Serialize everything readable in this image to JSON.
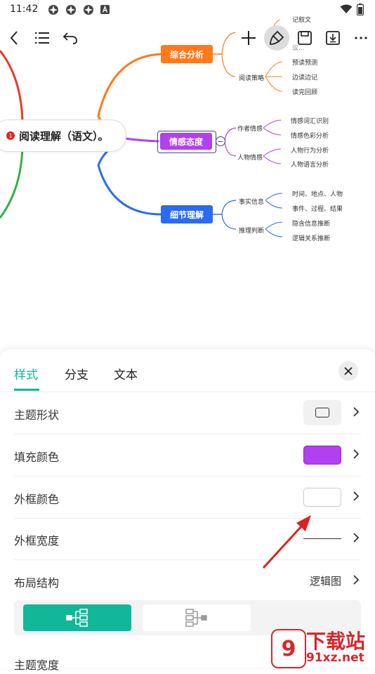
{
  "status_bar": {
    "time": "11:42"
  },
  "central_topic": {
    "label": "阅读理解（语文）。"
  },
  "branches": [
    {
      "label": "综合分析",
      "color": "#ff7a1a",
      "children": [
        {
          "label": "",
          "leaves": [
            "记叙文",
            "",
            "议..."
          ]
        },
        {
          "label": "阅读策略",
          "leaves": [
            "预读预测",
            "边读边记",
            "读完回顾"
          ]
        }
      ]
    },
    {
      "label": "情感态度",
      "color": "#b23ff0",
      "children": [
        {
          "label": "作者情感",
          "leaves": [
            "情感词汇识别",
            "情感色彩分析"
          ]
        },
        {
          "label": "人物情感",
          "leaves": [
            "人物行为分析",
            "人物语言分析"
          ]
        }
      ]
    },
    {
      "label": "细节理解",
      "color": "#2b6bef",
      "children": [
        {
          "label": "事实信息",
          "leaves": [
            "时间、地点、人物",
            "事件、过程、结果"
          ]
        },
        {
          "label": "推理判断",
          "leaves": [
            "隐含信息推断",
            "逻辑关系推断"
          ]
        }
      ]
    }
  ],
  "panel": {
    "tabs": [
      "样式",
      "分支",
      "文本"
    ],
    "rows": {
      "shape": "主题形状",
      "fill": "填充颜色",
      "border_color": "外框颜色",
      "border_width": "外框宽度",
      "layout": "布局结构",
      "layout_value": "逻辑图",
      "topic_width": "主题宽度"
    },
    "fill_color": "#b23ff0",
    "accent": "#12b79a"
  },
  "watermark": {
    "text1": "下载站",
    "text2": "91xz.net"
  }
}
